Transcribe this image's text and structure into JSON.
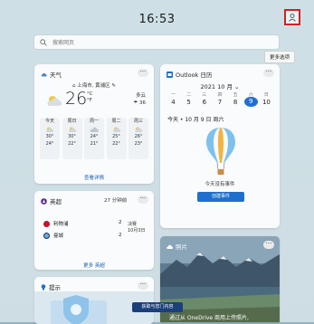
{
  "header": {
    "time": "16:53",
    "tooltip": "更多选项"
  },
  "search": {
    "placeholder": "搜索网页"
  },
  "weather": {
    "title": "天气",
    "location": "上海市, 黄浦区",
    "temperature": "26",
    "unit_top": "°C",
    "unit_bottom": "°F",
    "condition": "多云",
    "humidity": "☂ 36",
    "forecast": [
      {
        "day": "今天",
        "high": "30°",
        "low": "24°"
      },
      {
        "day": "周日",
        "high": "30°",
        "low": "22°"
      },
      {
        "day": "周一",
        "high": "24°",
        "low": "21°"
      },
      {
        "day": "周二",
        "high": "25°",
        "low": "22°"
      },
      {
        "day": "周三",
        "high": "26°",
        "low": "23°"
      }
    ],
    "more_link": "查看详情"
  },
  "calendar": {
    "title": "Outlook 日历",
    "month": "2021 10 月 ⌄",
    "weekdays": [
      "一",
      "二",
      "三",
      "四",
      "五",
      "六",
      "日"
    ],
    "dates": [
      "4",
      "5",
      "6",
      "7",
      "8",
      "9",
      "10"
    ],
    "today_index": 5,
    "today_label": "今天 • 10 月 9 日 周六",
    "no_events": "今天没有事件",
    "create_button": "创建事件"
  },
  "sports": {
    "title": "英超",
    "time_label": "27 分钟前",
    "team1": "利物浦",
    "team1_score": "2",
    "team2": "曼城",
    "team2_score": "2",
    "match_status": "决赛",
    "match_date": "10月3日",
    "more_link": "更多 英超"
  },
  "photos": {
    "title": "照片",
    "caption": "通过从 OneDrive 商用上传照片,"
  },
  "tips": {
    "title": "提示",
    "button": "获取与您门内容"
  },
  "colors": {
    "accent": "#1f6fce",
    "highlight_border": "#d42020"
  }
}
